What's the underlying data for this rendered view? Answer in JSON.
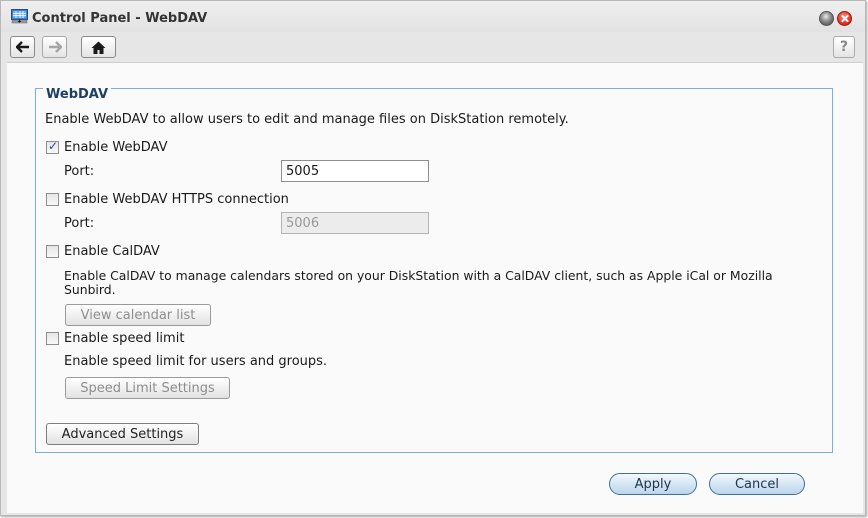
{
  "window": {
    "title": "Control Panel - WebDAV",
    "app_icon": "control-panel-icon",
    "controls": {
      "minimize": "minimize-icon",
      "close": "close-icon"
    }
  },
  "toolbar": {
    "back": "arrow-left-icon",
    "forward": "arrow-right-icon",
    "home": "home-icon",
    "help_label": "?"
  },
  "section": {
    "legend": "WebDAV",
    "description": "Enable WebDAV to allow users to edit and manage files on DiskStation remotely.",
    "webdav": {
      "label": "Enable WebDAV",
      "checked": true,
      "port_label": "Port:",
      "port_value": "5005"
    },
    "https": {
      "label": "Enable WebDAV HTTPS connection",
      "checked": false,
      "port_label": "Port:",
      "port_value": "5006",
      "disabled": true
    },
    "caldav": {
      "label": "Enable CalDAV",
      "checked": false,
      "description_line1": "Enable CalDAV to manage calendars stored on your DiskStation with a CalDAV client, such as Apple iCal or Mozilla",
      "description_line2": "Sunbird.",
      "button": "View calendar list"
    },
    "speed": {
      "label": "Enable speed limit",
      "checked": false,
      "description": "Enable speed limit for users and groups.",
      "button": "Speed Limit Settings"
    },
    "advanced_button": "Advanced Settings"
  },
  "footer": {
    "apply": "Apply",
    "cancel": "Cancel"
  },
  "colors": {
    "accent": "#7baed2",
    "legend": "#1d3f66",
    "close": "#e23b2b"
  }
}
